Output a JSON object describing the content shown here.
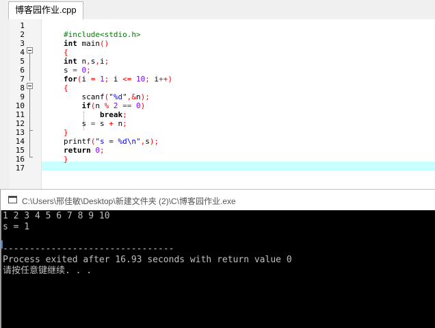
{
  "tab": {
    "label": "博客园作业.cpp"
  },
  "editor": {
    "line_numbers": [
      "1",
      "2",
      "3",
      "4",
      "5",
      "6",
      "7",
      "8",
      "9",
      "10",
      "11",
      "12",
      "13",
      "14",
      "15",
      "16",
      "17"
    ],
    "lines": [
      [],
      [
        {
          "t": "#include<stdio.h>",
          "c": "pp"
        }
      ],
      [
        {
          "t": "int",
          "c": "kw"
        },
        {
          "t": " main",
          "c": ""
        },
        {
          "t": "()",
          "c": "sym"
        }
      ],
      [
        {
          "t": "{",
          "c": "sym"
        }
      ],
      [
        {
          "t": "int",
          "c": "kw"
        },
        {
          "t": " n",
          "c": ""
        },
        {
          "t": ",",
          "c": "sym"
        },
        {
          "t": "s",
          "c": ""
        },
        {
          "t": ",",
          "c": "sym"
        },
        {
          "t": "i",
          "c": ""
        },
        {
          "t": ";",
          "c": "sym"
        }
      ],
      [
        {
          "t": "s ",
          "c": ""
        },
        {
          "t": "=",
          "c": "sym"
        },
        {
          "t": " ",
          "c": ""
        },
        {
          "t": "0",
          "c": "num"
        },
        {
          "t": ";",
          "c": "sym"
        }
      ],
      [
        {
          "t": "for",
          "c": "kw"
        },
        {
          "t": "(",
          "c": "sym"
        },
        {
          "t": "i ",
          "c": ""
        },
        {
          "t": "=",
          "c": "sym"
        },
        {
          "t": " ",
          "c": ""
        },
        {
          "t": "1",
          "c": "num"
        },
        {
          "t": ";",
          "c": "sym"
        },
        {
          "t": " i ",
          "c": ""
        },
        {
          "t": "<=",
          "c": "sym"
        },
        {
          "t": " ",
          "c": ""
        },
        {
          "t": "10",
          "c": "num"
        },
        {
          "t": ";",
          "c": "sym"
        },
        {
          "t": " i",
          "c": ""
        },
        {
          "t": "++)",
          "c": "sym"
        }
      ],
      [
        {
          "t": "{",
          "c": "sym"
        }
      ],
      [
        {
          "t": "    scanf",
          "c": ""
        },
        {
          "t": "(",
          "c": "sym"
        },
        {
          "t": "\"%d\"",
          "c": "str"
        },
        {
          "t": ",&",
          "c": "sym"
        },
        {
          "t": "n",
          "c": ""
        },
        {
          "t": ");",
          "c": "sym"
        }
      ],
      [
        {
          "t": "    ",
          "c": ""
        },
        {
          "t": "if",
          "c": "kw"
        },
        {
          "t": "(",
          "c": "sym"
        },
        {
          "t": "n ",
          "c": ""
        },
        {
          "t": "%",
          "c": "sym"
        },
        {
          "t": " ",
          "c": ""
        },
        {
          "t": "2",
          "c": "num"
        },
        {
          "t": " ",
          "c": ""
        },
        {
          "t": "==",
          "c": "sym"
        },
        {
          "t": " ",
          "c": ""
        },
        {
          "t": "0",
          "c": "num"
        },
        {
          "t": ")",
          "c": "sym"
        }
      ],
      [
        {
          "t": "        ",
          "c": ""
        },
        {
          "t": "break",
          "c": "kw"
        },
        {
          "t": ";",
          "c": "sym"
        }
      ],
      [
        {
          "t": "    s ",
          "c": ""
        },
        {
          "t": "=",
          "c": "sym"
        },
        {
          "t": " s ",
          "c": ""
        },
        {
          "t": "+",
          "c": "sym"
        },
        {
          "t": " n",
          "c": ""
        },
        {
          "t": ";",
          "c": "sym"
        }
      ],
      [
        {
          "t": "}",
          "c": "sym"
        }
      ],
      [
        {
          "t": "printf",
          "c": ""
        },
        {
          "t": "(",
          "c": "sym"
        },
        {
          "t": "\"s = %d\\n\"",
          "c": "str"
        },
        {
          "t": ",",
          "c": "sym"
        },
        {
          "t": "s",
          "c": ""
        },
        {
          "t": ");",
          "c": "sym"
        }
      ],
      [
        {
          "t": "return",
          "c": "kw"
        },
        {
          "t": " ",
          "c": ""
        },
        {
          "t": "0",
          "c": "num"
        },
        {
          "t": ";",
          "c": "sym"
        }
      ],
      [
        {
          "t": "}",
          "c": "sym"
        }
      ],
      []
    ]
  },
  "console": {
    "title": "C:\\Users\\邢佳敏\\Desktop\\新建文件夹 (2)\\C\\博客园作业.exe",
    "output_lines": [
      "1 2 3 4 5 6 7 8 9 10",
      "s = 1",
      "",
      "--------------------------------",
      "Process exited after 16.93 seconds with return value 0",
      "请按任意键继续. . ."
    ]
  },
  "colors": {
    "preprocessor": "#008000",
    "keyword": "#000000",
    "symbol": "#ff0000",
    "string": "#0000ff",
    "number": "#8000ff",
    "current_line": "#c8ffff",
    "console_bg": "#000000",
    "console_text": "#c0c0c0"
  }
}
